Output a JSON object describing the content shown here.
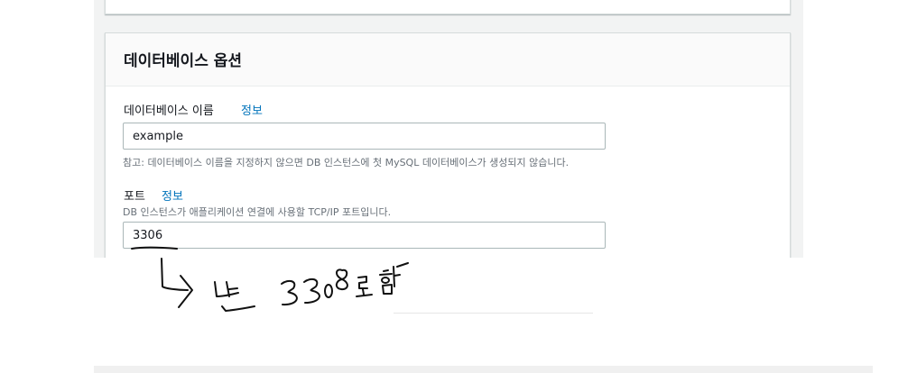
{
  "section": {
    "title": "데이터베이스 옵션"
  },
  "db_name": {
    "label": "데이터베이스 이름",
    "info_link": "정보",
    "value": "example",
    "hint": "참고: 데이터베이스 이름을 지정하지 않으면 DB 인스턴스에 첫 MySQL 데이터베이스가 생성되지 않습니다."
  },
  "port": {
    "label": "포트",
    "info_link": "정보",
    "description": "DB 인스턴스가 애플리케이션 연결에 사용할 TCP/IP 포트입니다.",
    "value": "3306"
  },
  "colors": {
    "link": "#0073bb",
    "page_background": "#f2f3f3",
    "panel_border": "#d5dbdb",
    "input_border": "#aab7b8",
    "hint_text": "#687078"
  }
}
